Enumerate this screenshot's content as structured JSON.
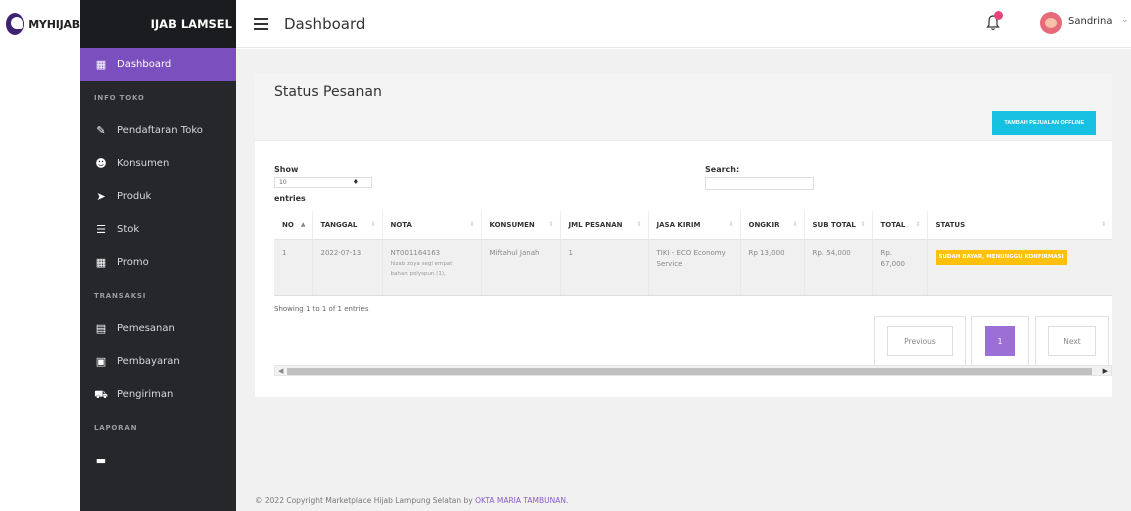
{
  "brand": {
    "name": "MYHIJAB"
  },
  "sidebar": {
    "title": "IJAB LAMSEL",
    "items": [
      {
        "type": "item",
        "label": "Dashboard",
        "icon": "store-icon",
        "active": true
      },
      {
        "type": "section",
        "label": "INFO TOKO"
      },
      {
        "type": "item",
        "label": "Pendaftaran Toko",
        "icon": "user-edit-icon"
      },
      {
        "type": "item",
        "label": "Konsumen",
        "icon": "users-icon"
      },
      {
        "type": "item",
        "label": "Produk",
        "icon": "truck-arrow-icon"
      },
      {
        "type": "item",
        "label": "Stok",
        "icon": "list-icon"
      },
      {
        "type": "item",
        "label": "Promo",
        "icon": "store-icon"
      },
      {
        "type": "section",
        "label": "TRANSAKSI"
      },
      {
        "type": "item",
        "label": "Pemesanan",
        "icon": "document-icon"
      },
      {
        "type": "item",
        "label": "Pembayaran",
        "icon": "wallet-icon"
      },
      {
        "type": "item",
        "label": "Pengiriman",
        "icon": "truck-icon"
      },
      {
        "type": "section",
        "label": "LAPORAN"
      },
      {
        "type": "item",
        "label": "",
        "icon": "report-icon"
      }
    ]
  },
  "topbar": {
    "title": "Dashboard",
    "user_name": "Sandrina"
  },
  "card": {
    "title": "Status Pesanan",
    "offline_button": "TAMBAH PEJUALAN OFFLINE",
    "show_label": "Show",
    "show_value": "10",
    "entries_label": "entries",
    "search_label": "Search:",
    "columns": [
      "NO",
      "TANGGAL",
      "NOTA",
      "KONSUMEN",
      "JML PESANAN",
      "JASA KIRIM",
      "ONGKIR",
      "SUB TOTAL",
      "TOTAL",
      "STATUS"
    ],
    "rows": [
      {
        "no": "1",
        "tanggal": "2022-07-13",
        "nota": "NT001164163",
        "nota_detail_1": "hizab zoya segi empat",
        "nota_detail_2": "bahan polyspun (1),",
        "konsumen": "Miftahul Janah",
        "jml": "1",
        "jasa": "TIKI - ECO Economy Service",
        "ongkir": "Rp 13,000",
        "subtotal": "Rp. 54,000",
        "total": "Rp. 67,000",
        "status": "SUDAH BAYAR, MENUNGGU KONFIRMASI"
      }
    ],
    "showing": "Showing 1 to 1 of 1 entries",
    "pagination": {
      "previous": "Previous",
      "current": "1",
      "next": "Next"
    }
  },
  "footer": {
    "text": "© 2022 Copyright Marketplace Hijab Lampung Selatan by ",
    "author": "OKTA MARIA TAMBUNAN",
    "end": "."
  },
  "colors": {
    "accent": "#7b4fbd",
    "sidebar_bg": "#25272b",
    "button_cyan": "#16c0e0",
    "status_yellow": "#ffc107"
  }
}
